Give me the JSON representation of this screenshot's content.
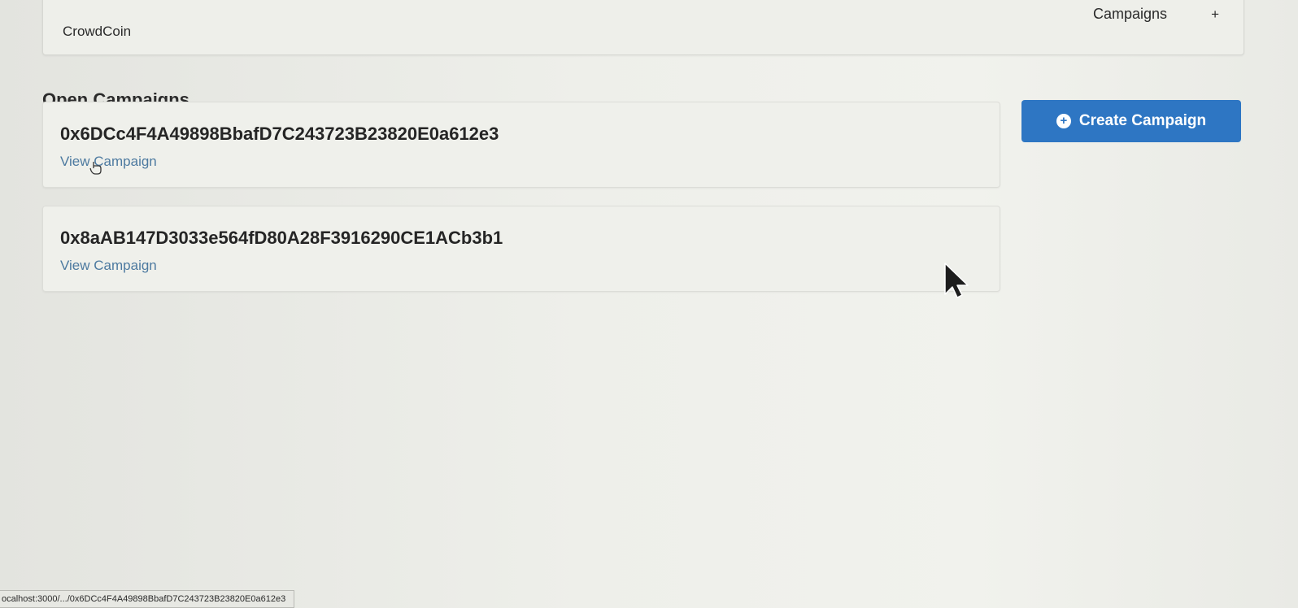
{
  "menu": {
    "brand": "CrowdCoin",
    "campaigns_label": "Campaigns",
    "add_label": "+"
  },
  "heading": "Open Campaigns",
  "campaigns": [
    {
      "address": "0x6DCc4F4A49898BbafD7C243723B23820E0a612e3",
      "link_label": "View Campaign"
    },
    {
      "address": "0x8aAB147D3033e564fD80A28F3916290CE1ACb3b1",
      "link_label": "View Campaign"
    }
  ],
  "create_button": {
    "label": "Create Campaign",
    "icon": "plus-circle-icon"
  },
  "status_bar": {
    "url": "ocalhost:3000/.../0x6DCc4F4A49898BbafD7C243723B23820E0a612e3"
  },
  "colors": {
    "primary_button": "#2e76c3",
    "link": "#4d7aa0"
  }
}
